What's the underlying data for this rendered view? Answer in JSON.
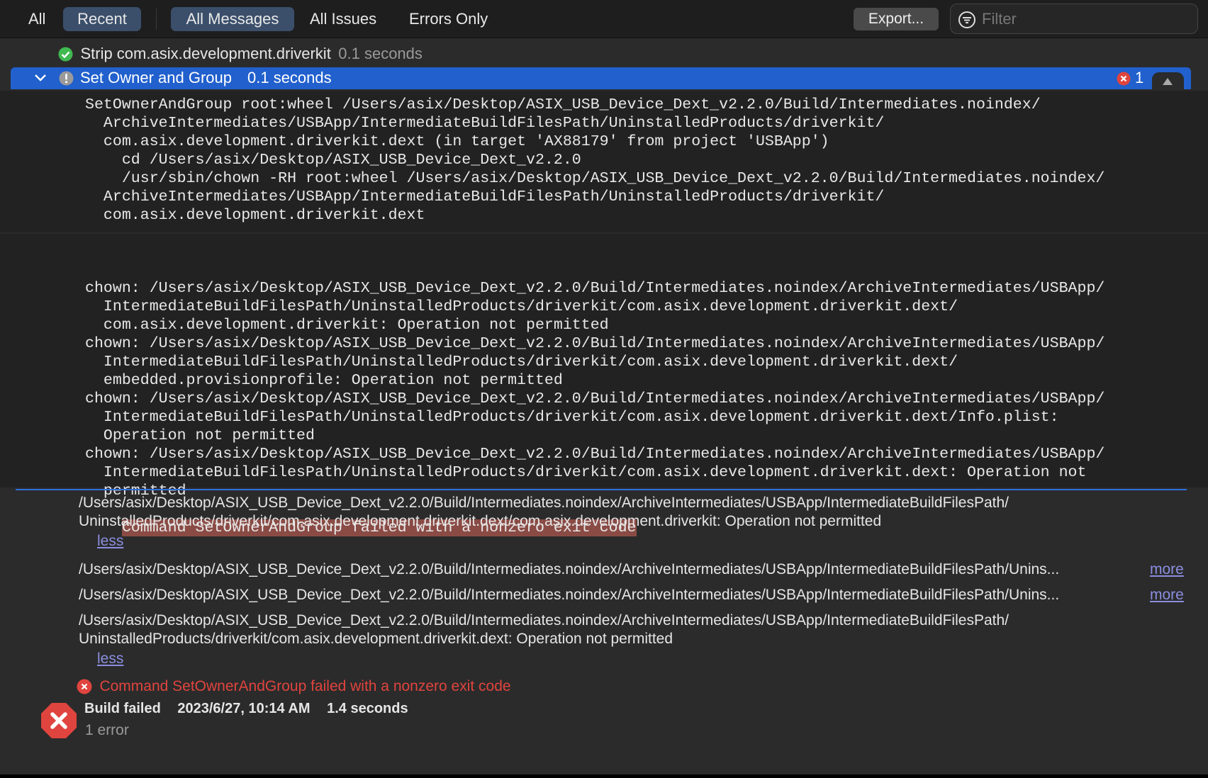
{
  "toolbar": {
    "scope_tabs": [
      "All",
      "Recent"
    ],
    "filter_tabs": [
      "All Messages",
      "All Issues",
      "Errors Only"
    ],
    "export_label": "Export...",
    "filter_placeholder": "Filter"
  },
  "steps": [
    {
      "title": "Strip com.asix.development.driverkit",
      "duration": "0.1 seconds",
      "status": "success"
    },
    {
      "title": "Set Owner and Group",
      "duration": "0.1 seconds",
      "status": "warning",
      "error_count": "1"
    }
  ],
  "log_command": [
    "SetOwnerAndGroup root:wheel /Users/asix/Desktop/ASIX_USB_Device_Dext_v2.2.0/Build/Intermediates.noindex/",
    "  ArchiveIntermediates/USBApp/IntermediateBuildFilesPath/UninstalledProducts/driverkit/",
    "  com.asix.development.driverkit.dext (in target 'AX88179' from project 'USBApp')",
    "    cd /Users/asix/Desktop/ASIX_USB_Device_Dext_v2.2.0",
    "    /usr/sbin/chown -RH root:wheel /Users/asix/Desktop/ASIX_USB_Device_Dext_v2.2.0/Build/Intermediates.noindex/",
    "  ArchiveIntermediates/USBApp/IntermediateBuildFilesPath/UninstalledProducts/driverkit/",
    "  com.asix.development.driverkit.dext"
  ],
  "log_output": [
    "chown: /Users/asix/Desktop/ASIX_USB_Device_Dext_v2.2.0/Build/Intermediates.noindex/ArchiveIntermediates/USBApp/",
    "  IntermediateBuildFilesPath/UninstalledProducts/driverkit/com.asix.development.driverkit.dext/",
    "  com.asix.development.driverkit: Operation not permitted",
    "chown: /Users/asix/Desktop/ASIX_USB_Device_Dext_v2.2.0/Build/Intermediates.noindex/ArchiveIntermediates/USBApp/",
    "  IntermediateBuildFilesPath/UninstalledProducts/driverkit/com.asix.development.driverkit.dext/",
    "  embedded.provisionprofile: Operation not permitted",
    "chown: /Users/asix/Desktop/ASIX_USB_Device_Dext_v2.2.0/Build/Intermediates.noindex/ArchiveIntermediates/USBApp/",
    "  IntermediateBuildFilesPath/UninstalledProducts/driverkit/com.asix.development.driverkit.dext/Info.plist:",
    "  Operation not permitted",
    "chown: /Users/asix/Desktop/ASIX_USB_Device_Dext_v2.2.0/Build/Intermediates.noindex/ArchiveIntermediates/USBApp/",
    "  IntermediateBuildFilesPath/UninstalledProducts/driverkit/com.asix.development.driverkit.dext: Operation not",
    "  permitted"
  ],
  "log_error": "Command SetOwnerAndGroup failed with a nonzero exit code",
  "issues": [
    {
      "lines": [
        "/Users/asix/Desktop/ASIX_USB_Device_Dext_v2.2.0/Build/Intermediates.noindex/ArchiveIntermediates/USBApp/IntermediateBuildFilesPath/",
        "UninstalledProducts/driverkit/com.asix.development.driverkit.dext/com.asix.development.driverkit: Operation not permitted"
      ],
      "toggle": "less"
    },
    {
      "lines": [
        "/Users/asix/Desktop/ASIX_USB_Device_Dext_v2.2.0/Build/Intermediates.noindex/ArchiveIntermediates/USBApp/IntermediateBuildFilesPath/Unins..."
      ],
      "toggle": "more"
    },
    {
      "lines": [
        "/Users/asix/Desktop/ASIX_USB_Device_Dext_v2.2.0/Build/Intermediates.noindex/ArchiveIntermediates/USBApp/IntermediateBuildFilesPath/Unins..."
      ],
      "toggle": "more"
    },
    {
      "lines": [
        "/Users/asix/Desktop/ASIX_USB_Device_Dext_v2.2.0/Build/Intermediates.noindex/ArchiveIntermediates/USBApp/IntermediateBuildFilesPath/",
        "UninstalledProducts/driverkit/com.asix.development.driverkit.dext: Operation not permitted"
      ],
      "toggle": "less"
    }
  ],
  "error_message": "Command SetOwnerAndGroup failed with a nonzero exit code",
  "summary": {
    "status": "Build failed",
    "date": "2023/6/27, 10:14 AM",
    "duration": "1.4 seconds",
    "errors": "1 error"
  },
  "colors": {
    "selection": "#2160cd",
    "error": "#e0443e",
    "success": "#3fb950",
    "link": "#8b8ee0"
  }
}
